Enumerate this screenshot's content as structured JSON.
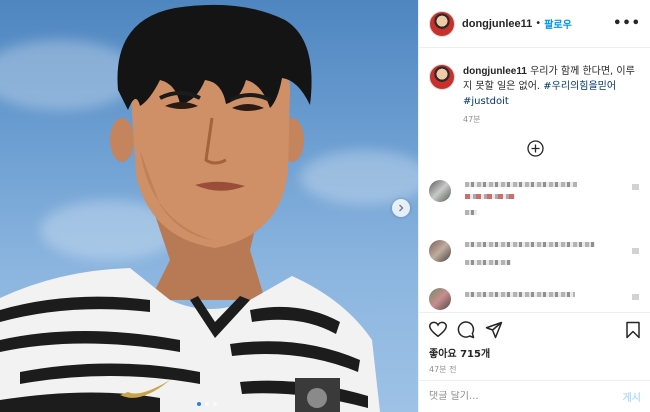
{
  "post": {
    "username": "dongjunlee11",
    "separator": "•",
    "follow_label": "팔로우",
    "more_icon": "more-horizontal-icon",
    "caption": {
      "username": "dongjunlee11",
      "text": " 우리가 함께 한다면, 이루지 못할 일은 없어. ",
      "hashtag1": "#우리의힘을믿어",
      "hashtag2": "#justdoit"
    },
    "caption_time": "47분",
    "likes": "좋아요 715개",
    "post_time": "47분 전",
    "comment_placeholder": "댓글 달기...",
    "post_label": "게시"
  },
  "carousel": {
    "slides": 3,
    "active": 1
  },
  "colors": {
    "follow": "#0095f6",
    "hashtag": "#00376b",
    "muted": "#8e8e8e",
    "active_dot": "#2f7ce6"
  }
}
